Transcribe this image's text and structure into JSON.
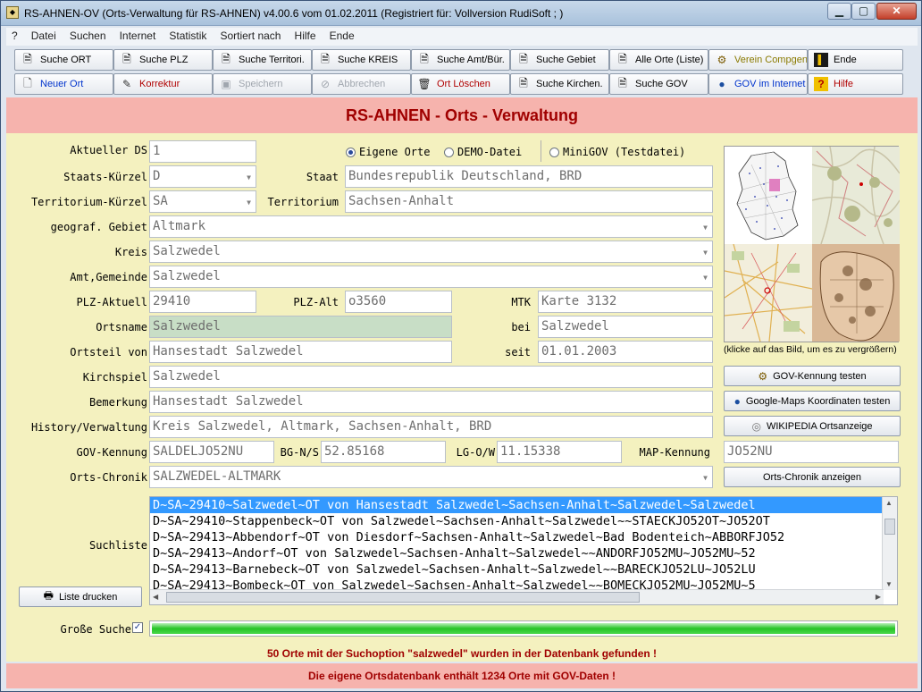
{
  "window": {
    "title": "RS-AHNEN-OV (Orts-Verwaltung für RS-AHNEN) v4.00.6 vom 01.02.2011 (Registriert für: Vollversion RudiSoft ; )",
    "icon": "app-icon"
  },
  "menu": [
    "?",
    "Datei",
    "Suchen",
    "Internet",
    "Statistik",
    "Sortiert nach",
    "Hilfe",
    "Ende"
  ],
  "toolbar": {
    "row1": [
      {
        "label": "Suche ORT",
        "icon": "search-doc-icon"
      },
      {
        "label": "Suche PLZ",
        "icon": "search-doc-icon"
      },
      {
        "label": "Suche Territori.",
        "icon": "search-doc-icon"
      },
      {
        "label": "Suche KREIS",
        "icon": "search-doc-icon"
      },
      {
        "label": "Suche Amt/Bür.",
        "icon": "search-doc-icon"
      },
      {
        "label": "Suche Gebiet",
        "icon": "search-doc-icon"
      },
      {
        "label": "Alle Orte (Liste)",
        "icon": "search-doc-icon"
      },
      {
        "label": "Verein Compgen",
        "icon": "compgen-icon"
      },
      {
        "label": "Ende",
        "icon": "exit-door-icon"
      }
    ],
    "row2": [
      {
        "label": "Neuer Ort",
        "icon": "new-doc-icon"
      },
      {
        "label": "Korrektur",
        "icon": "edit-icon"
      },
      {
        "label": "Speichern",
        "icon": "save-icon"
      },
      {
        "label": "Abbrechen",
        "icon": "cancel-icon"
      },
      {
        "label": "Ort Löschen",
        "icon": "trash-icon"
      },
      {
        "label": "Suche Kirchen.",
        "icon": "search-doc-icon"
      },
      {
        "label": "Suche GOV",
        "icon": "search-doc-icon"
      },
      {
        "label": "GOV im Internet",
        "icon": "globe-icon"
      },
      {
        "label": "Hilfe",
        "icon": "help-icon"
      }
    ]
  },
  "header": {
    "title": "RS-AHNEN - Orts - Verwaltung"
  },
  "form": {
    "aktueller_ds": {
      "label": "Aktueller DS",
      "value": "1"
    },
    "radios": [
      {
        "label": "Eigene Orte",
        "checked": true
      },
      {
        "label": "DEMO-Datei",
        "checked": false
      },
      {
        "label": "MiniGOV (Testdatei)",
        "checked": false
      }
    ],
    "staats_kuerzel": {
      "label": "Staats-Kürzel",
      "value": "D"
    },
    "staat": {
      "label": "Staat",
      "value": "Bundesrepublik Deutschland, BRD"
    },
    "territorium_kuerzel": {
      "label": "Territorium-Kürzel",
      "value": "SA"
    },
    "territorium": {
      "label": "Territorium",
      "value": "Sachsen-Anhalt"
    },
    "gebiet": {
      "label": "geograf. Gebiet",
      "value": "Altmark"
    },
    "kreis": {
      "label": "Kreis",
      "value": "Salzwedel"
    },
    "amt": {
      "label": "Amt,Gemeinde",
      "value": "Salzwedel"
    },
    "plz_aktuell": {
      "label": "PLZ-Aktuell",
      "value": "29410"
    },
    "plz_alt": {
      "label": "PLZ-Alt",
      "value": "o3560"
    },
    "mtk": {
      "label": "MTK",
      "value": "Karte 3132"
    },
    "ortsname": {
      "label": "Ortsname",
      "value": "Salzwedel"
    },
    "bei": {
      "label": "bei",
      "value": "Salzwedel"
    },
    "ortsteil_von": {
      "label": "Ortsteil von",
      "value": "Hansestadt Salzwedel"
    },
    "seit": {
      "label": "seit",
      "value": "01.01.2003"
    },
    "kirchspiel": {
      "label": "Kirchspiel",
      "value": "Salzwedel"
    },
    "bemerkung": {
      "label": "Bemerkung",
      "value": "Hansestadt Salzwedel"
    },
    "history": {
      "label": "History/Verwaltung",
      "value": "Kreis Salzwedel, Altmark, Sachsen-Anhalt, BRD"
    },
    "gov_kennung": {
      "label": "GOV-Kennung",
      "value": "SALDELJO52NU"
    },
    "bg_ns": {
      "label": "BG-N/S",
      "value": "52.85168"
    },
    "lg_ow": {
      "label": "LG-O/W",
      "value": "11.15338"
    },
    "map_kennung": {
      "label": "MAP-Kennung",
      "value": "JO52NU"
    },
    "orts_chronik": {
      "label": "Orts-Chronik",
      "value": "SALZWEDEL-ALTMARK"
    },
    "suchliste": {
      "label": "Suchliste"
    },
    "grosse_suche": {
      "label": "Große Suche",
      "checked": true
    }
  },
  "maps_caption": "(klicke auf das Bild, um es zu vergrößern)",
  "side_buttons": [
    {
      "label": "GOV-Kennung testen",
      "icon": "compgen-icon"
    },
    {
      "label": "Google-Maps Koordinaten testen",
      "icon": "globe-icon"
    },
    {
      "label": "WIKIPEDIA Ortsanzeige",
      "icon": "wikipedia-icon"
    },
    {
      "label": "Orts-Chronik anzeigen",
      "icon": ""
    }
  ],
  "print_button": {
    "label": "Liste drucken",
    "icon": "printer-icon"
  },
  "suchliste_rows": [
    "D~SA~29410~Salzwedel~OT von Hansestadt Salzwedel~Sachsen-Anhalt~Salzwedel~Salzwedel",
    "D~SA~29410~Stappenbeck~OT von Salzwedel~Sachsen-Anhalt~Salzwedel~~STAECKJO52OT~JO52OT",
    "D~SA~29413~Abbendorf~OT von Diesdorf~Sachsen-Anhalt~Salzwedel~Bad Bodenteich~ABBORFJO52",
    "D~SA~29413~Andorf~OT von Salzwedel~Sachsen-Anhalt~Salzwedel~~ANDORFJO52MU~JO52MU~52",
    "D~SA~29413~Barnebeck~OT von Salzwedel~Sachsen-Anhalt~Salzwedel~~BARECKJO52LU~JO52LU",
    "D~SA~29413~Bombeck~OT von Salzwedel~Sachsen-Anhalt~Salzwedel~~BOMECKJO52MU~JO52MU~5"
  ],
  "selected_row": 0,
  "progress": 1.0,
  "status_search": "50 Orte mit der Suchoption \"salzwedel\" wurden in der Datenbank gefunden !",
  "status_db": "Die eigene Ortsdatenbank enthält 1234 Orte mit GOV-Daten !",
  "colors": {
    "accent_red": "#a00000",
    "header_bg": "#f6b3ad",
    "form_bg": "#f4f1bf",
    "selection": "#3399ff"
  }
}
